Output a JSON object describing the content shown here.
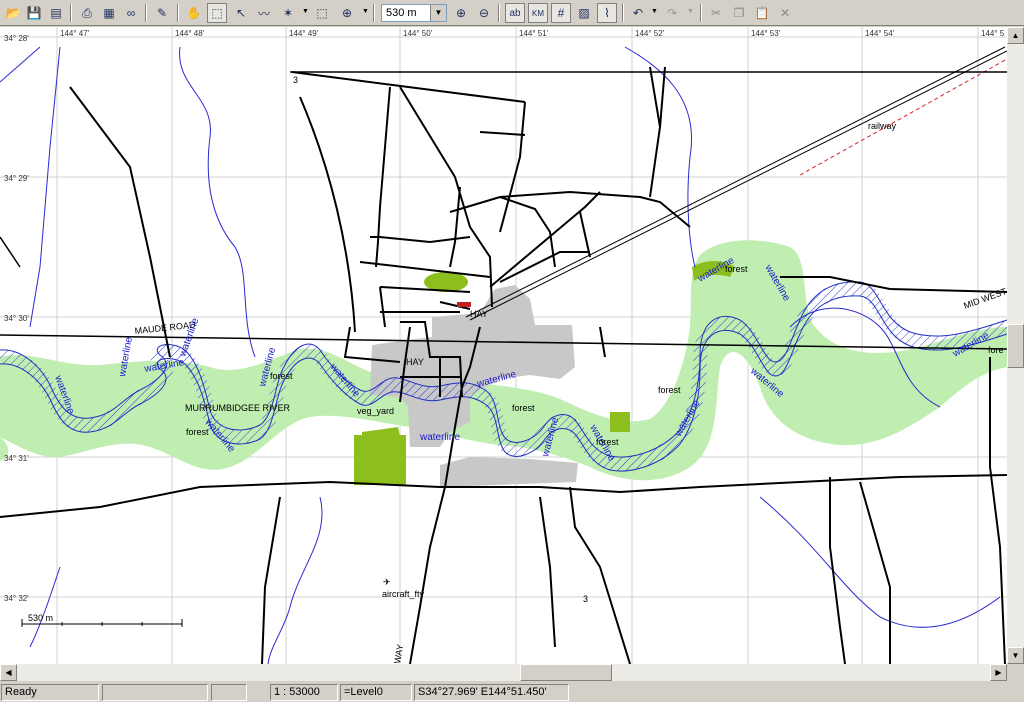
{
  "toolbar": {
    "scale_value": "530 m",
    "icons": [
      "open-folder",
      "save",
      "export",
      "print",
      "properties",
      "binoculars",
      "layer-tool",
      "hand-pan",
      "zoom-rectangle",
      "select-arrow",
      "polyline",
      "magic-wand",
      "select-region",
      "pan-target",
      "zoom-in",
      "zoom-out",
      "label-ab",
      "km-label",
      "grid",
      "hatch",
      "paperclip",
      "undo",
      "redo",
      "cut",
      "copy",
      "paste",
      "delete"
    ]
  },
  "map": {
    "lat_labels": [
      "34° 28'",
      "34° 29'",
      "34° 30'",
      "34° 31'",
      "34° 32'"
    ],
    "lon_labels": [
      "144° 47'",
      "144° 48'",
      "144° 49'",
      "144° 50'",
      "144° 51'",
      "144° 52'",
      "144° 53'",
      "144° 54'",
      "144° 5"
    ],
    "labels": {
      "maude_road": "MAUDE ROAD",
      "murrumbidgee": "MURRUMBIDGEE RIVER",
      "railway": "railway",
      "hay1": "HAY",
      "hay2": "HAY",
      "aircraft": "aircraft_fty",
      "highway": "WAY",
      "mid_west": "MID WEST",
      "num3a": "3",
      "num3b": "3",
      "veg": "veg_yard",
      "forest1": "forest",
      "forest2": "forest",
      "forest3": "forest",
      "forest4": "forest",
      "forest5": "forest",
      "forest6": "fore",
      "forest7": "forest",
      "waterline": "waterline",
      "scale_bar": "530 m"
    }
  },
  "status": {
    "ready": "Ready",
    "scale": "1 : 53000",
    "level": "=Level0",
    "coords": "S34°27.969' E144°51.450'"
  }
}
